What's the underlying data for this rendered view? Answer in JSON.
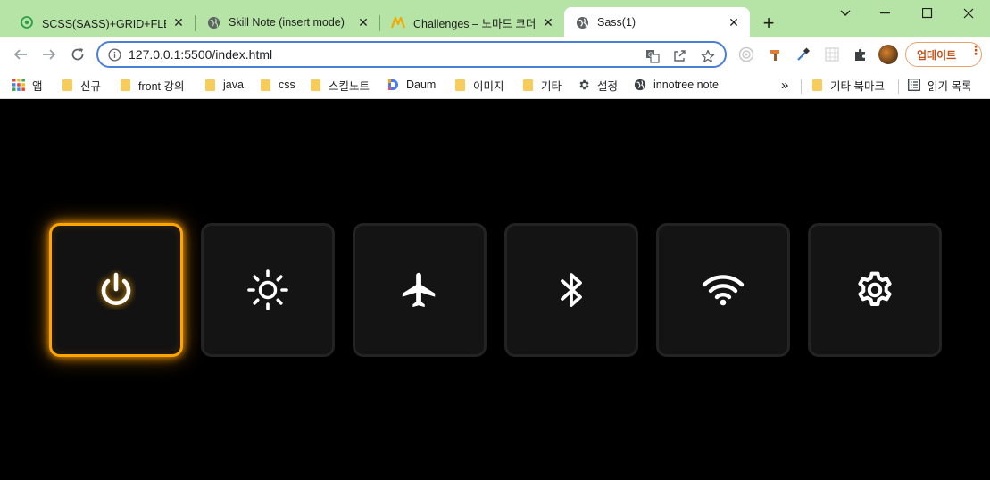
{
  "tabs": [
    {
      "title": "SCSS(SASS)+GRID+FLEX 실",
      "icon": "target-favicon-icon",
      "active": false
    },
    {
      "title": "Skill Note (insert mode)",
      "icon": "globe-icon",
      "active": false
    },
    {
      "title": "Challenges – 노마드 코더",
      "icon": "nomad-logo-icon",
      "active": false
    },
    {
      "title": "Sass(1)",
      "icon": "globe-icon",
      "active": true
    }
  ],
  "address_bar": {
    "url": "127.0.0.1:5500/index.html"
  },
  "update_button": {
    "label": "업데이트"
  },
  "bookmarks": [
    {
      "label": "앱",
      "icon": "apps-grid-icon"
    },
    {
      "label": "신규",
      "icon": "folder-icon"
    },
    {
      "label": "front 강의",
      "icon": "folder-icon"
    },
    {
      "label": "java",
      "icon": "folder-icon"
    },
    {
      "label": "css",
      "icon": "folder-icon"
    },
    {
      "label": "스킬노트",
      "icon": "folder-icon"
    },
    {
      "label": "Daum",
      "icon": "daum-logo-icon"
    },
    {
      "label": "이미지",
      "icon": "folder-icon"
    },
    {
      "label": "기타",
      "icon": "folder-icon"
    },
    {
      "label": "설정",
      "icon": "gear-icon"
    },
    {
      "label": "innotree note",
      "icon": "globe-icon"
    }
  ],
  "bookmarks_right": [
    {
      "label": "기타 북마크",
      "icon": "folder-icon"
    },
    {
      "label": "읽기 목록",
      "icon": "reading-list-icon"
    }
  ],
  "control_tiles": [
    {
      "name": "power",
      "icon": "power-icon",
      "active": true
    },
    {
      "name": "brightness",
      "icon": "sun-icon",
      "active": false
    },
    {
      "name": "airplane-mode",
      "icon": "airplane-icon",
      "active": false
    },
    {
      "name": "bluetooth",
      "icon": "bluetooth-icon",
      "active": false
    },
    {
      "name": "wifi",
      "icon": "wifi-icon",
      "active": false
    },
    {
      "name": "settings",
      "icon": "gear-icon",
      "active": false
    }
  ],
  "colors": {
    "tabstrip": "#b6e3a6",
    "accent_glow": "#ffa500",
    "tile_bg": "#141414",
    "page_bg": "#000000",
    "omnibox_border": "#4a7fd8"
  }
}
